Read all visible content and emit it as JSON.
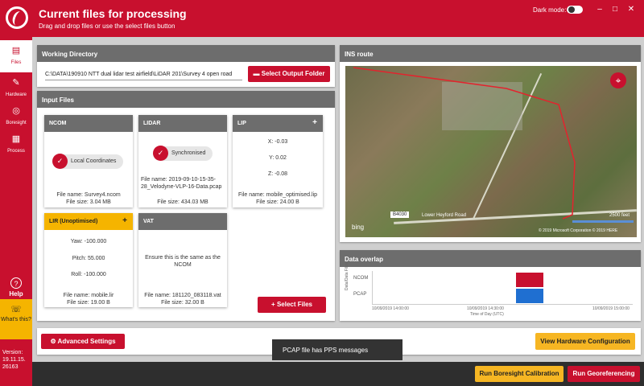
{
  "window": {
    "title": "Current files for processing",
    "subtitle": "Drag and drop files or use the select files button",
    "dark_mode_label": "Dark mode:",
    "minimize": "–",
    "maximize": "□",
    "close": "✕"
  },
  "sidebar": {
    "items": [
      {
        "label": "Files",
        "icon": "file-icon"
      },
      {
        "label": "Hardware",
        "icon": "wrench-icon"
      },
      {
        "label": "Boresight",
        "icon": "target-icon"
      },
      {
        "label": "Process",
        "icon": "calculator-icon"
      }
    ],
    "help_label": "Help",
    "whats_this_label": "What's this?",
    "version": "Version: 19.11.15. 26163"
  },
  "working_directory": {
    "header": "Working Directory",
    "path": "C:\\DATA\\190910 NTT dual lidar test airfield\\LiDAR 201\\Survey 4 open road",
    "button": "Select Output Folder"
  },
  "input_files": {
    "header": "Input Files",
    "ncom": {
      "title": "NCOM",
      "status": "Local Coordinates",
      "file_name": "File name: Survey4.ncom",
      "file_size": "File size: 3.04 MB"
    },
    "lidar": {
      "title": "LIDAR",
      "status": "Synchronised",
      "file_name": "File name: 2019-09-10-15-35-28_Velodyne-VLP-16-Data.pcap",
      "file_size": "File size: 434.03 MB"
    },
    "lip": {
      "title": "LIP",
      "x": "X: -0.03",
      "y": "Y: 0.02",
      "z": "Z: -0.08",
      "file_name": "File name: mobile_optimised.lip",
      "file_size": "File size: 24.00 B"
    },
    "lir": {
      "title": "LIR (Unoptimised)",
      "yaw": "Yaw: -100.000",
      "pitch": "Pitch: 55.000",
      "roll": "Roll: -100.000",
      "file_name": "File name: mobile.lir",
      "file_size": "File size: 19.00 B"
    },
    "vat": {
      "title": "VAT",
      "note": "Ensure this is the same as the NCOM",
      "file_name": "File name: 181120_083118.vat",
      "file_size": "File size: 32.00 B"
    },
    "select_button": "Select Files"
  },
  "ins_route": {
    "header": "INS route",
    "road_label": "Lower Heyford Road",
    "road_number": "B4030",
    "scale": "2500 feet",
    "bing": "bing",
    "copyright": "© 2019 Microsoft Corporation   © 2019 HERE"
  },
  "data_overlap": {
    "header": "Data overlap",
    "y_axis": "Data/Data Files",
    "rows": [
      "NCOM",
      "PCAP"
    ],
    "x_ticks": [
      "10/09/2019 14:00:00",
      "10/09/2019 14:30:00",
      "10/09/2019 15:00:00"
    ],
    "x_label": "Time of Day (UTC)",
    "colors": {
      "ncom": "#c8102e",
      "pcap": "#1f6fd1"
    }
  },
  "actions": {
    "advanced": "Advanced Settings",
    "hardware_config": "View Hardware Configuration",
    "boresight": "Run Boresight Calibration",
    "georef": "Run Georeferencing"
  },
  "toast": "PCAP file has PPS messages",
  "colors": {
    "brand": "#c8102e",
    "accent": "#f6b623"
  }
}
